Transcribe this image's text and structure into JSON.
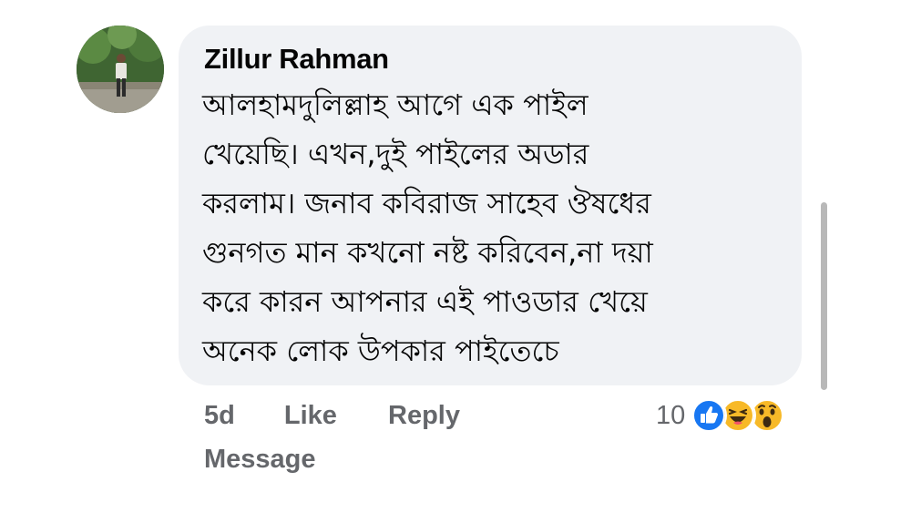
{
  "comment": {
    "author": "Zillur Rahman",
    "lines": [
      "আলহামদুলিল্লাহ আগে এক পাইল",
      "খেয়েছি। এখন,দুই পাইলের অডার",
      "করলাম। জনাব কবিরাজ সাহেব ঔষধের",
      "গুনগত মান কখনো নষ্ট করিবেন,না দয়া",
      "করে কারন আপনার এই পাওডার খেয়ে",
      "অনেক লোক উপকার পাইতেচে"
    ],
    "timestamp": "5d",
    "like_label": "Like",
    "reply_label": "Reply",
    "message_label": "Message",
    "reaction_count": "10",
    "reactions": [
      "like-icon",
      "haha-icon",
      "wow-icon"
    ]
  },
  "colors": {
    "bubble_bg": "#f0f2f5",
    "secondary_text": "#65676b",
    "like_blue": "#1877f2",
    "emoji_yellow": "#f7b928"
  }
}
